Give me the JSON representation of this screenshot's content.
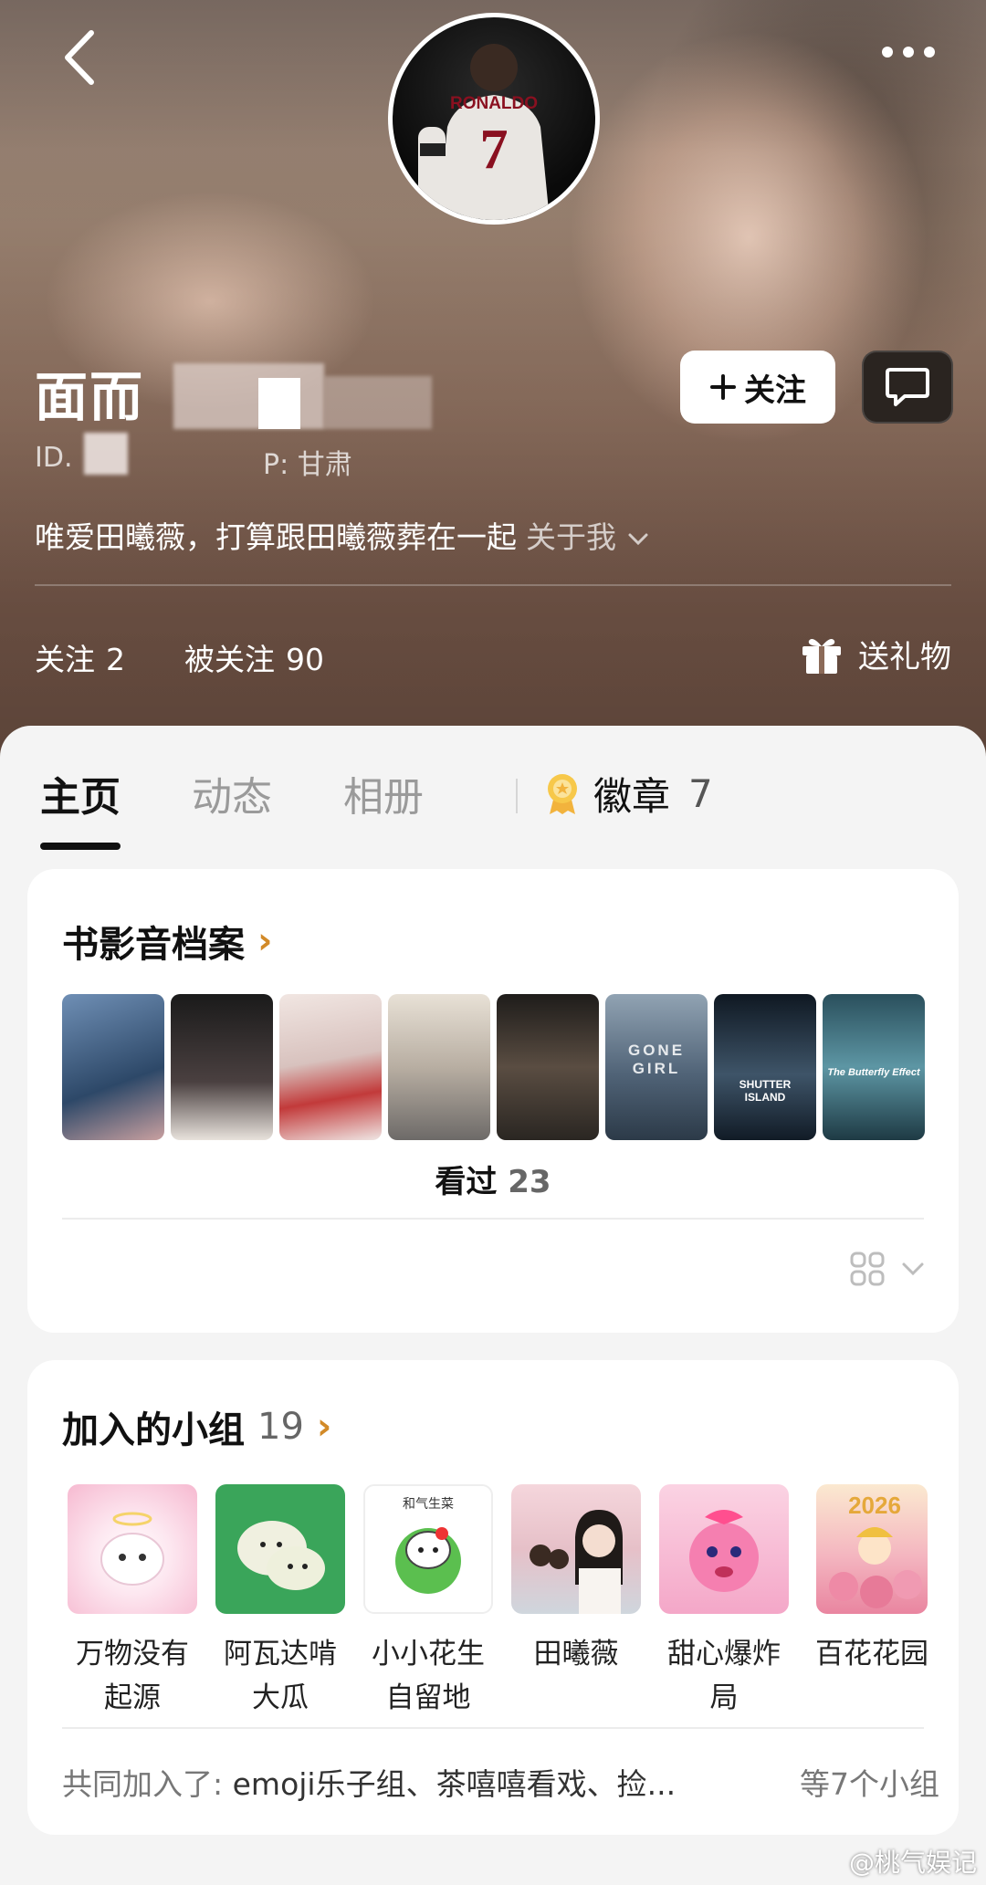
{
  "header": {
    "nickname": "面而",
    "id_prefix": "ID.",
    "ip_location": "P: 甘肃",
    "follow_label": "关注",
    "bio": "唯爱田曦薇，打算跟田曦薇葬在一起",
    "about_label": "关于我",
    "following_label": "关注",
    "following_count": "2",
    "followers_label": "被关注",
    "followers_count": "90",
    "gift_label": "送礼物",
    "avatar_jersey_name": "RONALDO",
    "avatar_jersey_number": "7"
  },
  "tabs": [
    {
      "label": "主页",
      "active": true
    },
    {
      "label": "动态",
      "active": false
    },
    {
      "label": "相册",
      "active": false
    }
  ],
  "badge": {
    "label": "徽章",
    "count": "7"
  },
  "media_card": {
    "title": "书影音档案",
    "posters": [
      {
        "label": "",
        "color": "#3d5a7a"
      },
      {
        "label": "",
        "color": "#2b2b2b"
      },
      {
        "label": "",
        "color": "#d9c9c4"
      },
      {
        "label": "",
        "color": "#bfb6ab"
      },
      {
        "label": "",
        "color": "#3a3530"
      },
      {
        "label": "GONE GIRL",
        "color": "#5c6e80"
      },
      {
        "label": "SHUTTER ISLAND",
        "color": "#22303e"
      },
      {
        "label": "The Butterfly Effect",
        "color": "#3f6b78"
      }
    ],
    "watched_label": "看过",
    "watched_count": "23"
  },
  "groups_card": {
    "title": "加入的小组",
    "count": "19",
    "groups": [
      {
        "name": "万物没有起源",
        "color": "#f7c6d8"
      },
      {
        "name": "阿瓦达啃大瓜",
        "color": "#3aa55a"
      },
      {
        "name": "小小花生自留地",
        "color": "#ffffff"
      },
      {
        "name": "田曦薇",
        "color": "#e9c7cf"
      },
      {
        "name": "甜心爆炸局",
        "color": "#f29cc0"
      },
      {
        "name": "百花花园",
        "color": "#f0a8b8"
      }
    ],
    "thumb_texts": {
      "group3": "和气生菜",
      "group6": "2026"
    },
    "common_prefix": "共同加入了:",
    "common_list": "emoji乐子组、茶嘻嘻看戏、捡...",
    "common_suffix": "等7个小组"
  },
  "watermark": "@桃气娱记",
  "colors": {
    "accent_chevron": "#d28a28",
    "sheet_bg": "#f4f4f4"
  }
}
